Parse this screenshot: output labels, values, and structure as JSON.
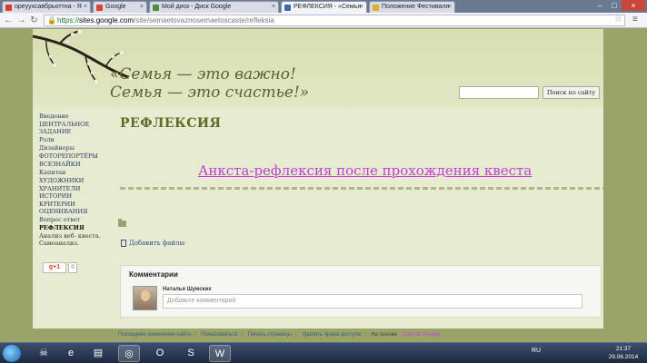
{
  "browser": {
    "tabs": [
      {
        "label": "ореуухсавбрьоттна - Я"
      },
      {
        "label": "Google"
      },
      {
        "label": "Мой диск - Диск Google"
      },
      {
        "label": "РЕФЛЕКСИЯ - «Семья"
      },
      {
        "label": "Положение Фестиваля"
      }
    ],
    "url": {
      "scheme": "https://",
      "host": "sites.google.com",
      "path": "/site/semaetovaznosemaetoscaste/refleksia"
    }
  },
  "site": {
    "title_line1": "«Семья — это важно!",
    "title_line2": "Семья — это счастье!»",
    "search_button": "Поиск по сайту"
  },
  "sidebar": {
    "items": [
      "Введение",
      "ЦЕНТРАЛЬНОЕ ЗАДАНИЕ",
      "Роли",
      "Дизайнеры",
      "ФОТОРЕПОРТЁРЫ",
      "ВСЕЗНАЙКИ",
      "Капитан",
      "ХУДОЖНИКИ",
      "ХРАНИТЕЛИ ИСТОРИИ",
      "КРИТЕРИИ ОЦЕНИВАНИЯ",
      "Вопрос ответ",
      "РЕФЛЕКСИЯ",
      "Анализ веб- квеста. Самоанализ."
    ],
    "gplus_label": "g+1",
    "gplus_count": "0"
  },
  "main": {
    "page_title": "РЕФЛЕКСИЯ",
    "link_text": "Анкста-рефлексия после прохождения квеста",
    "attach_label": "Добавить файлы"
  },
  "comments": {
    "title": "Комментарии",
    "author": "Наталья Шумских",
    "placeholder": "Добавьте комментарий"
  },
  "footer": {
    "links": [
      "Последние изменения сайта",
      "Пожаловаться",
      "Печать страницы",
      "Удалить права доступа"
    ],
    "powered_text": "На основе",
    "powered_link": "Сайтов Google"
  },
  "taskbar": {
    "lang": "RU",
    "time": "21:37",
    "date": "29.06.2014"
  }
}
